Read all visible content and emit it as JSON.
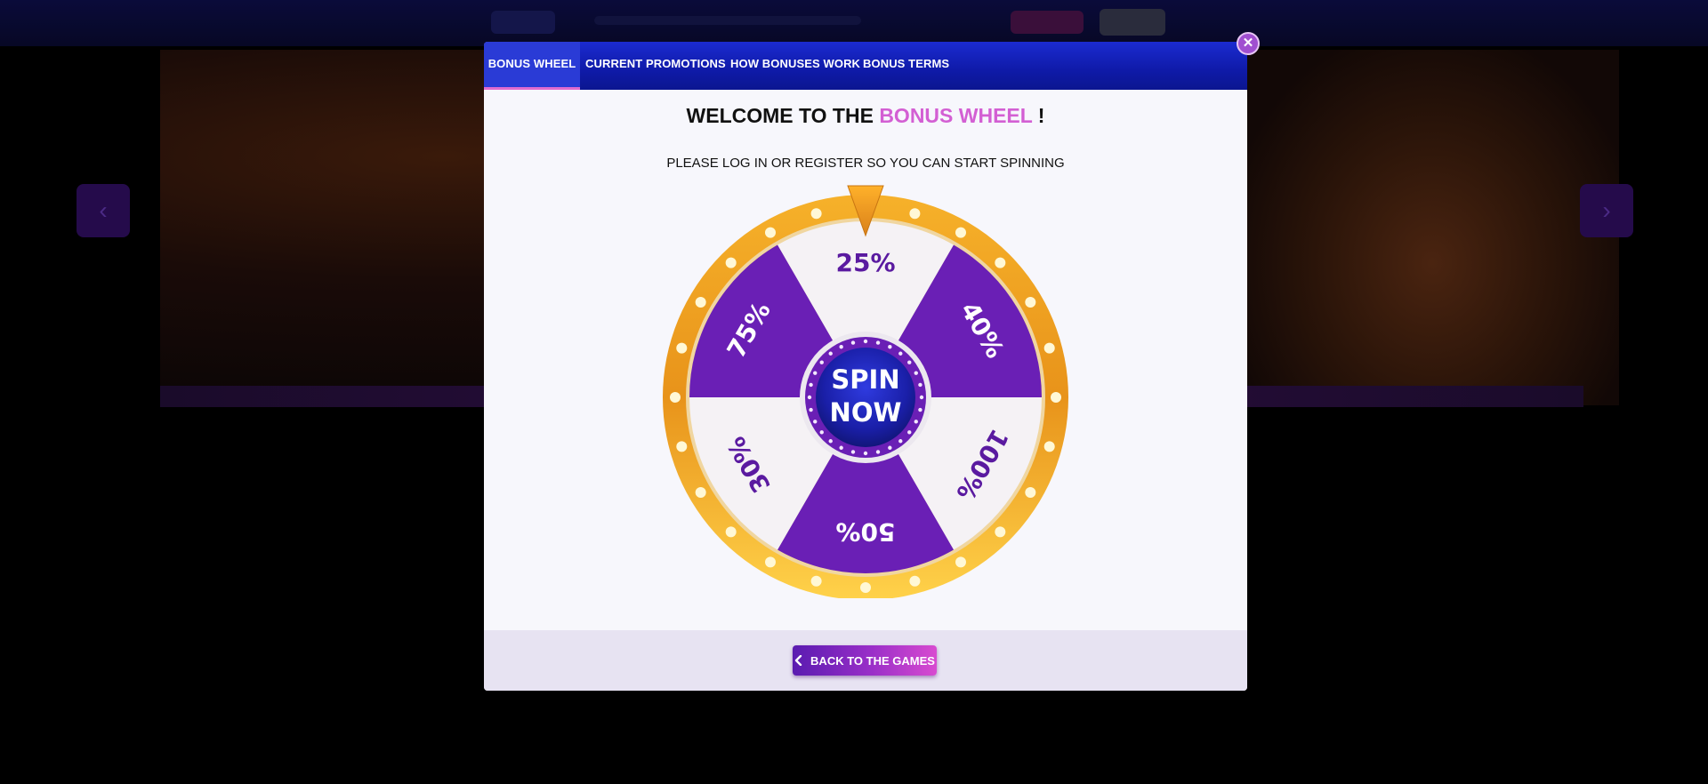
{
  "modal": {
    "tabs": [
      {
        "label": "BONUS WHEEL",
        "active": true
      },
      {
        "label": "CURRENT PROMOTIONS",
        "active": false
      },
      {
        "label": "HOW BONUSES WORK",
        "active": false
      },
      {
        "label": "BONUS TERMS",
        "active": false
      }
    ],
    "heading_prefix": "WELCOME TO THE",
    "heading_accent": "BONUS WHEEL",
    "heading_suffix": "!",
    "subheading": "PLEASE LOG IN OR REGISTER SO YOU CAN START SPINNING",
    "close_label": "✕",
    "back_button": {
      "label": "BACK TO THE GAMES",
      "icon": "chevron-left-icon"
    }
  },
  "wheel": {
    "segments": [
      {
        "label": "25%",
        "color": "#f5f2f5"
      },
      {
        "label": "40%",
        "color": "#6a1fb5"
      },
      {
        "label": "100%",
        "color": "#f5f2f5"
      },
      {
        "label": "50%",
        "color": "#6a1fb5"
      },
      {
        "label": "30%",
        "color": "#f5f2f5"
      },
      {
        "label": "75%",
        "color": "#6a1fb5"
      }
    ],
    "center_line1": "SPIN",
    "center_line2": "NOW",
    "rim_color": "#f2a51e",
    "pointer_color": "#f0a020"
  },
  "colors": {
    "accent": "#d35fd3",
    "tab_bar": "#1421b8",
    "purple": "#6a1fb5"
  }
}
